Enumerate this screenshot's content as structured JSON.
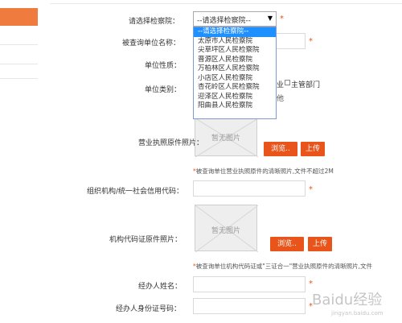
{
  "form": {
    "procuratorate": {
      "label": "请选择检察院：",
      "selected": "--请选择检察院--",
      "options": [
        "--请选择检察院--",
        "太原市人民检察院",
        "尖草坪区人民检察院",
        "晋源区人民检察院",
        "万柏林区人民检察院",
        "小店区人民检察院",
        "杏花岭区人民检察院",
        "迎泽区人民检察院",
        "阳曲县人民检察院"
      ]
    },
    "unit_name": {
      "label": "被查询单位名称："
    },
    "unit_nature": {
      "label": "单位性质："
    },
    "unit_category": {
      "label": "单位类别：",
      "partial_text": "业",
      "option_supervisor": "主管部门",
      "partial_text2": "他"
    },
    "business_license": {
      "label": "营业执照原件照片：",
      "placeholder_text": "暂无图片",
      "browse_label": "浏览..",
      "upload_label": "上传",
      "hint": "*被查询单位营业执照原件的清晰照片,文件不超过2M"
    },
    "org_code": {
      "label": "组织机构/统一社会信用代码："
    },
    "org_code_cert": {
      "label": "机构代码证原件照片：",
      "placeholder_text": "暂无图片",
      "browse_label": "浏览..",
      "upload_label": "上传",
      "hint": "*被查询单位机构代码证或\"三证合一\"营业执照原件的清晰照片,文件"
    },
    "agent_name": {
      "label": "经办人姓名："
    },
    "agent_id": {
      "label": "经办人身份证号码："
    },
    "required_mark": "*"
  },
  "watermark": {
    "text": "Baidu经验",
    "sub": "jingyan.baidu.com"
  },
  "colors": {
    "accent": "#e9541b",
    "sidebar_active": "#f07b3f",
    "dropdown_selected": "#1e90ff"
  }
}
